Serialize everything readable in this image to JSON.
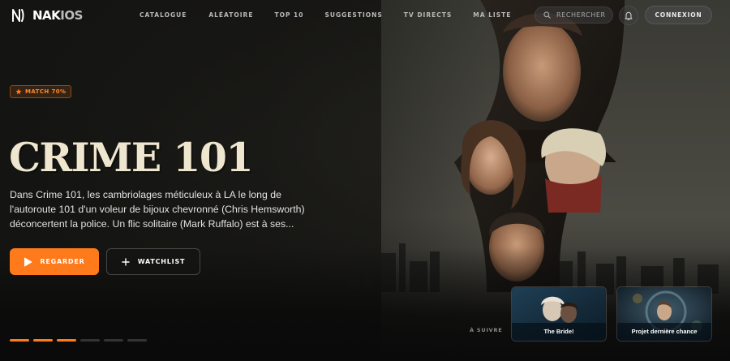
{
  "brand": {
    "name_part1": "NAK",
    "name_part2": "IOS"
  },
  "nav": {
    "items": [
      "CATALOGUE",
      "ALÉATOIRE",
      "TOP 10",
      "SUGGESTIONS",
      "TV DIRECTS",
      "MA LISTE"
    ],
    "search_label": "RECHERCHER",
    "login_label": "CONNEXION"
  },
  "hero": {
    "match_label": "MATCH 70%",
    "title": "CRIME 101",
    "description": "Dans Crime 101, les cambriolages méticuleux à LA le long de l'autoroute 101 d'un voleur de bijoux chevronné (Chris Hemsworth) déconcertent la police. Un flic solitaire (Mark Ruffalo) est à ses...",
    "watch_label": "REGARDER",
    "watchlist_label": "WATCHLIST",
    "slides_total": 6,
    "slide_active": 3
  },
  "up_next": {
    "label": "À SUIVRE",
    "cards": [
      {
        "title": "The Bride!"
      },
      {
        "title": "Projet dernière chance"
      }
    ]
  },
  "colors": {
    "accent": "#ff7a1a",
    "title": "#efe6cf",
    "background": "#0b0b0b"
  },
  "icons": [
    "logo-mark-icon",
    "search-icon",
    "bell-icon",
    "star-icon",
    "play-icon",
    "plus-icon"
  ]
}
